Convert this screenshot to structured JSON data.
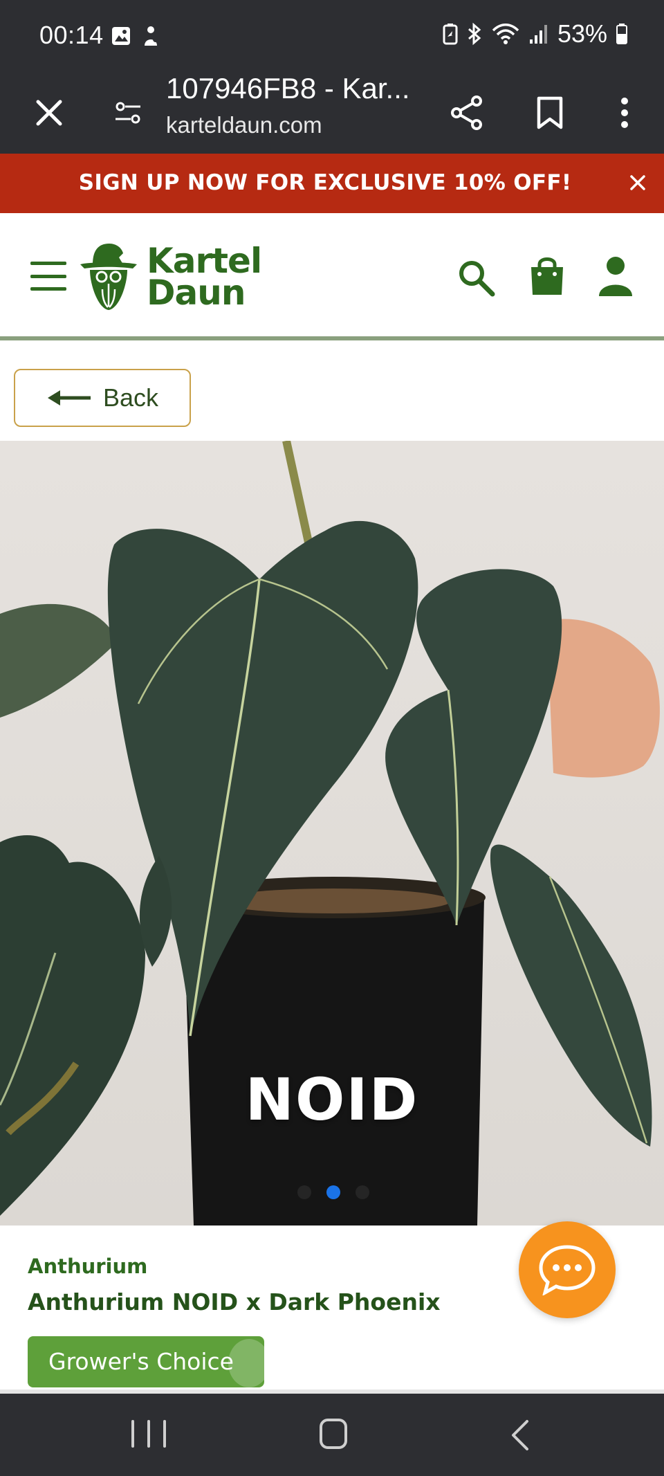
{
  "status_bar": {
    "time": "00:14",
    "battery": "53%",
    "icons": [
      "gallery-icon",
      "notification-icon",
      "battery-saver-icon",
      "bluetooth-icon",
      "wifi-icon",
      "signal-icon",
      "battery-icon"
    ]
  },
  "browser": {
    "page_title": "107946FB8 - Kar...",
    "url": "karteldaun.com",
    "icons": [
      "close-icon",
      "tune-icon",
      "share-icon",
      "bookmark-icon",
      "more-icon"
    ]
  },
  "promo": {
    "text": "SIGN UP NOW FOR EXCLUSIVE 10% OFF!"
  },
  "header": {
    "logo_line1": "Kartel",
    "logo_line2": "Daun",
    "brand_color": "#2e6a1f"
  },
  "back": {
    "label": "Back"
  },
  "product": {
    "image_caption": "NOID",
    "carousel": {
      "count": 3,
      "active_index": 1
    },
    "category": "Anthurium",
    "name": "Anthurium NOID x Dark Phoenix",
    "badge": "Grower's Choice",
    "badge_color": "#5ea03a"
  },
  "chat": {
    "fab_color": "#f7931e"
  },
  "colors": {
    "promo_bg": "#b62a12",
    "system_bar_bg": "#2d2e32",
    "carousel_active": "#1a73e8"
  }
}
